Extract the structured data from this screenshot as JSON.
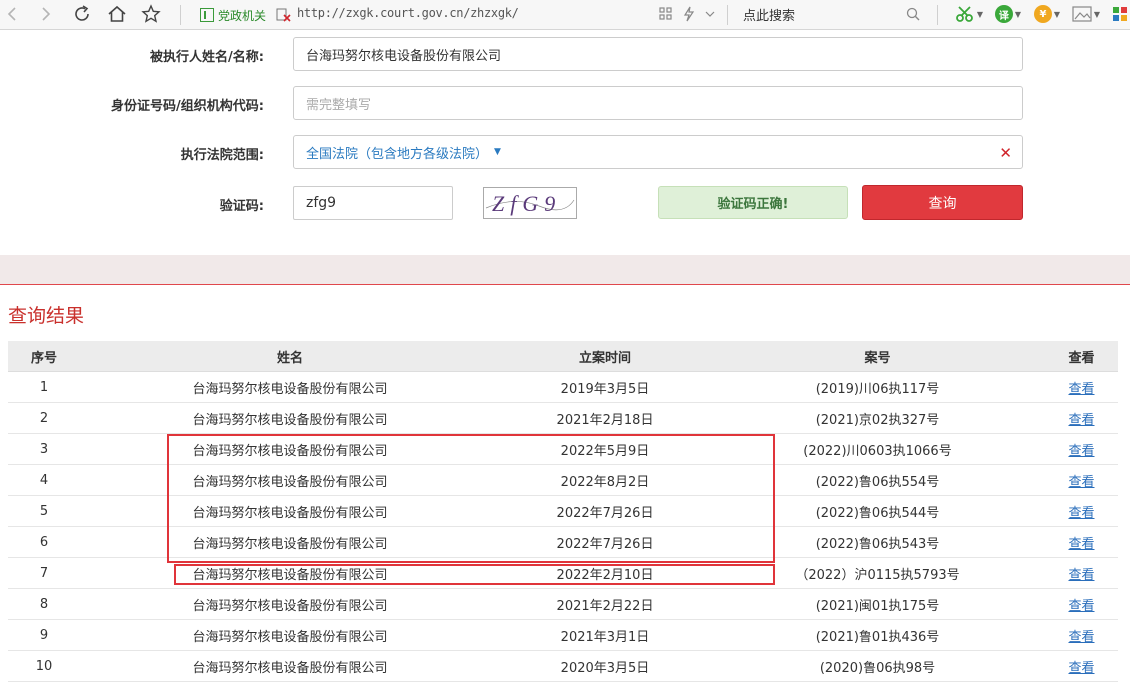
{
  "browser": {
    "site_badge": "党政机关",
    "url": "http://zxgk.court.gov.cn/zhzxgk/",
    "search_placeholder": "点此搜索"
  },
  "form": {
    "name_label": "被执行人姓名/名称:",
    "name_value": "台海玛努尔核电设备股份有限公司",
    "id_label": "身份证号码/组织机构代码:",
    "id_placeholder": "需完整填写",
    "court_label": "执行法院范围:",
    "court_value": "全国法院（包含地方各级法院）",
    "captcha_label": "验证码:",
    "captcha_value": "zfg9",
    "captcha_image_text": "ZfG9",
    "captcha_status": "验证码正确!",
    "query_button": "查询"
  },
  "results": {
    "title": "查询结果",
    "headers": [
      "序号",
      "姓名",
      "立案时间",
      "案号",
      "查看"
    ],
    "rows": [
      {
        "no": "1",
        "name": "台海玛努尔核电设备股份有限公司",
        "date": "2019年3月5日",
        "case": "(2019)川06执117号",
        "view": "查看"
      },
      {
        "no": "2",
        "name": "台海玛努尔核电设备股份有限公司",
        "date": "2021年2月18日",
        "case": "(2021)京02执327号",
        "view": "查看"
      },
      {
        "no": "3",
        "name": "台海玛努尔核电设备股份有限公司",
        "date": "2022年5月9日",
        "case": "(2022)川0603执1066号",
        "view": "查看"
      },
      {
        "no": "4",
        "name": "台海玛努尔核电设备股份有限公司",
        "date": "2022年8月2日",
        "case": "(2022)鲁06执554号",
        "view": "查看"
      },
      {
        "no": "5",
        "name": "台海玛努尔核电设备股份有限公司",
        "date": "2022年7月26日",
        "case": "(2022)鲁06执544号",
        "view": "查看"
      },
      {
        "no": "6",
        "name": "台海玛努尔核电设备股份有限公司",
        "date": "2022年7月26日",
        "case": "(2022)鲁06执543号",
        "view": "查看"
      },
      {
        "no": "7",
        "name": "台海玛努尔核电设备股份有限公司",
        "date": "2022年2月10日",
        "case": "（2022）沪0115执5793号",
        "view": "查看"
      },
      {
        "no": "8",
        "name": "台海玛努尔核电设备股份有限公司",
        "date": "2021年2月22日",
        "case": "(2021)闽01执175号",
        "view": "查看"
      },
      {
        "no": "9",
        "name": "台海玛努尔核电设备股份有限公司",
        "date": "2021年3月1日",
        "case": "(2021)鲁01执436号",
        "view": "查看"
      },
      {
        "no": "10",
        "name": "台海玛努尔核电设备股份有限公司",
        "date": "2020年3月5日",
        "case": "(2020)鲁06执98号",
        "view": "查看"
      }
    ]
  },
  "colors": {
    "accent_red": "#e13a3f",
    "link_blue": "#2a6ebb",
    "success_green": "#3c763d"
  }
}
